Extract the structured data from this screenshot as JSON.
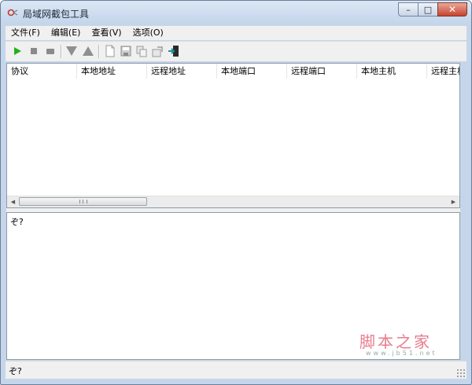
{
  "window": {
    "title": "局域网截包工具",
    "icon": "app-icon",
    "controls": {
      "minimize_glyph": "–",
      "maximize_glyph": "□",
      "close_glyph": "✕"
    }
  },
  "menubar": {
    "items": [
      {
        "label": "文件(F)"
      },
      {
        "label": "编辑(E)"
      },
      {
        "label": "查看(V)"
      },
      {
        "label": "选项(O)"
      }
    ]
  },
  "toolbar": {
    "buttons": [
      {
        "icon": "play-icon",
        "color": "#21b21b"
      },
      {
        "icon": "stop-icon",
        "color": "#8a8a8a"
      },
      {
        "icon": "pause-icon",
        "color": "#8a8a8a"
      },
      {
        "icon": "arrow-down-icon",
        "color": "#8f8f8f"
      },
      {
        "icon": "arrow-up-icon",
        "color": "#8f8f8f"
      },
      {
        "icon": "new-file-icon",
        "color": "#9a9a9a"
      },
      {
        "icon": "save-icon",
        "color": "#9a9a9a"
      },
      {
        "icon": "copy-icon",
        "color": "#9a9a9a"
      },
      {
        "icon": "properties-icon",
        "color": "#9a9a9a"
      },
      {
        "icon": "exit-icon",
        "color": "#1b8f9a"
      }
    ]
  },
  "packet_list": {
    "columns": [
      "协议",
      "本地地址",
      "远程地址",
      "本地端口",
      "远程端口",
      "本地主机",
      "远程主机"
    ],
    "rows": []
  },
  "detail": {
    "text": "ぞ?"
  },
  "watermark": {
    "main": "脚本之家",
    "url": "www.jb51.net"
  },
  "statusbar": {
    "text": "ぞ?"
  }
}
